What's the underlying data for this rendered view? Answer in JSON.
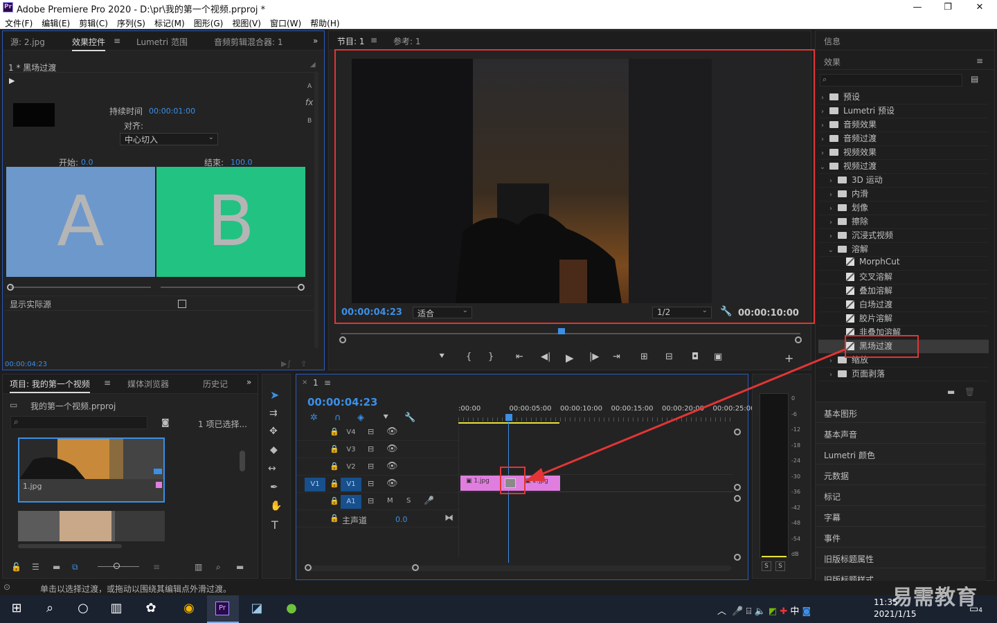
{
  "titlebar": {
    "icon": "Pr",
    "title": "Adobe Premiere Pro 2020 - D:\\pr\\我的第一个视频.prproj *",
    "minimize": "—",
    "maximize": "❐",
    "close": "✕"
  },
  "menu": [
    "文件(F)",
    "编辑(E)",
    "剪辑(C)",
    "序列(S)",
    "标记(M)",
    "图形(G)",
    "视图(V)",
    "窗口(W)",
    "帮助(H)"
  ],
  "effect_controls": {
    "tabs": [
      "源: 2.jpg",
      "效果控件",
      "Lumetri 范围",
      "音频剪辑混合器: 1"
    ],
    "active_tab": "效果控件",
    "clip_name": "1 * 黑场过渡",
    "duration_label": "持续时间",
    "duration_value": "00:00:01:00",
    "align_label": "对齐:",
    "align_value": "中心切入",
    "start_label": "开始:",
    "start_value": "0.0",
    "end_label": "结束:",
    "end_value": "100.0",
    "preview_a": "A",
    "preview_b": "B",
    "side_labels": [
      "A",
      "fx",
      "B"
    ],
    "show_actual": "显示实际源",
    "timecode": "00:00:04:23",
    "colors": {
      "a": "#6d98cc",
      "b": "#22c283"
    }
  },
  "program": {
    "tabs": [
      "节目: 1",
      "参考: 1"
    ],
    "timecode": "00:00:04:23",
    "fit": "适合",
    "resolution": "1/2",
    "duration": "00:00:10:00",
    "playhead_fraction": 0.48
  },
  "right_panel": {
    "info_tab": "信息",
    "effects_tab": "效果",
    "tree": [
      {
        "label": "预设",
        "level": 0,
        "kind": "folder",
        "open": false
      },
      {
        "label": "Lumetri 预设",
        "level": 0,
        "kind": "folder",
        "open": false
      },
      {
        "label": "音频效果",
        "level": 0,
        "kind": "folder",
        "open": false
      },
      {
        "label": "音频过渡",
        "level": 0,
        "kind": "folder",
        "open": false
      },
      {
        "label": "视频效果",
        "level": 0,
        "kind": "folder",
        "open": false
      },
      {
        "label": "视频过渡",
        "level": 0,
        "kind": "folder",
        "open": true
      },
      {
        "label": "3D 运动",
        "level": 1,
        "kind": "folder",
        "open": false
      },
      {
        "label": "内滑",
        "level": 1,
        "kind": "folder",
        "open": false
      },
      {
        "label": "划像",
        "level": 1,
        "kind": "folder",
        "open": false
      },
      {
        "label": "擦除",
        "level": 1,
        "kind": "folder",
        "open": false
      },
      {
        "label": "沉浸式视频",
        "level": 1,
        "kind": "folder",
        "open": false
      },
      {
        "label": "溶解",
        "level": 1,
        "kind": "folder",
        "open": true
      },
      {
        "label": "MorphCut",
        "level": 2,
        "kind": "effect"
      },
      {
        "label": "交叉溶解",
        "level": 2,
        "kind": "effect"
      },
      {
        "label": "叠加溶解",
        "level": 2,
        "kind": "effect"
      },
      {
        "label": "白场过渡",
        "level": 2,
        "kind": "effect"
      },
      {
        "label": "胶片溶解",
        "level": 2,
        "kind": "effect"
      },
      {
        "label": "非叠加溶解",
        "level": 2,
        "kind": "effect"
      },
      {
        "label": "黑场过渡",
        "level": 2,
        "kind": "effect",
        "selected": true
      },
      {
        "label": "缩放",
        "level": 1,
        "kind": "folder",
        "open": false
      },
      {
        "label": "页面剥落",
        "level": 1,
        "kind": "folder",
        "open": false
      }
    ],
    "panels": [
      "基本图形",
      "基本声音",
      "Lumetri 颜色",
      "元数据",
      "标记",
      "字幕",
      "事件",
      "旧版标题属性",
      "旧版标题样式"
    ]
  },
  "project": {
    "tabs": [
      "项目: 我的第一个视频",
      "媒体浏览器",
      "历史记"
    ],
    "file": "我的第一个视频.prproj",
    "selection": "1 项已选择...",
    "items": [
      {
        "name": "1.jpg"
      },
      {
        "name": ""
      }
    ]
  },
  "timeline": {
    "tab": "1",
    "timecode": "00:00:04:23",
    "ruler": [
      ":00:00",
      "00:00:05:00",
      "00:00:10:00",
      "00:00:15:00",
      "00:00:20:00",
      "00:00:25:00"
    ],
    "tracks": [
      "V4",
      "V3",
      "V2",
      "V1",
      "A1"
    ],
    "source_track": "V1",
    "master_label": "主声道",
    "master_value": "0.0",
    "clips": [
      {
        "name": "1.jpg"
      },
      {
        "name": "2.jpg"
      }
    ],
    "clip_color": "#e07ee0"
  },
  "audio_meter": {
    "ticks": [
      "0",
      "-6",
      "-12",
      "-18",
      "-24",
      "-30",
      "-36",
      "-42",
      "-48",
      "-54",
      "dB"
    ],
    "solo": [
      "S",
      "S"
    ]
  },
  "status_text": "单击以选择过渡，或拖动以围绕其编辑点外滑过渡。",
  "taskbar": {
    "time": "11:35",
    "date": "2021/1/15",
    "lang": "中",
    "notif": "4"
  },
  "watermark": "易需教育"
}
